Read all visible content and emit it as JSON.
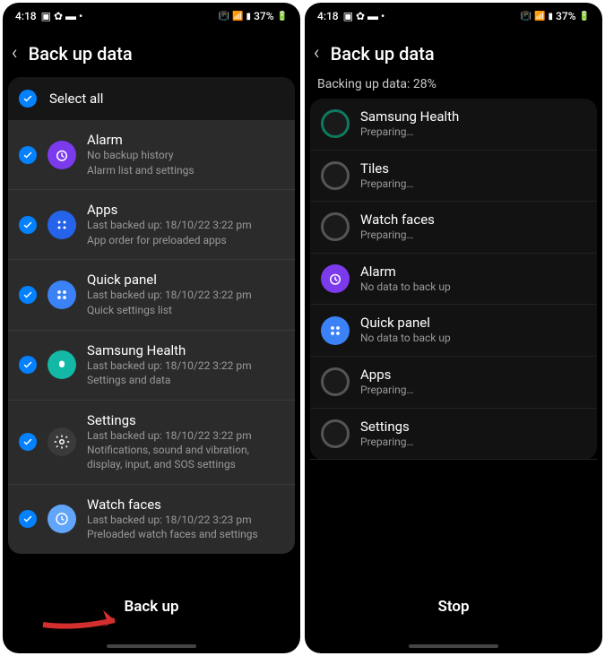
{
  "status": {
    "time": "4:18",
    "battery": "37%"
  },
  "left": {
    "title": "Back up data",
    "select_all": "Select all",
    "items": [
      {
        "title": "Alarm",
        "sub": "No backup history",
        "desc": "Alarm list and settings"
      },
      {
        "title": "Apps",
        "sub": "Last backed up: 18/10/22 3:22 pm",
        "desc": "App order for preloaded apps"
      },
      {
        "title": "Quick panel",
        "sub": "Last backed up: 18/10/22 3:22 pm",
        "desc": "Quick settings list"
      },
      {
        "title": "Samsung Health",
        "sub": "Last backed up: 18/10/22 3:22 pm",
        "desc": "Settings and data"
      },
      {
        "title": "Settings",
        "sub": "Last backed up: 18/10/22 3:22 pm",
        "desc": "Notifications, sound and vibration, display, input, and SOS settings"
      },
      {
        "title": "Watch faces",
        "sub": "Last backed up: 18/10/22 3:23 pm",
        "desc": "Preloaded watch faces and settings"
      }
    ],
    "button": "Back up"
  },
  "right": {
    "title": "Back up data",
    "progress": "Backing up data: 28%",
    "items": [
      {
        "title": "Samsung Health",
        "sub": "Preparing…"
      },
      {
        "title": "Tiles",
        "sub": "Preparing…"
      },
      {
        "title": "Watch faces",
        "sub": "Preparing…"
      },
      {
        "title": "Alarm",
        "sub": "No data to back up"
      },
      {
        "title": "Quick panel",
        "sub": "No data to back up"
      },
      {
        "title": "Apps",
        "sub": "Preparing…"
      },
      {
        "title": "Settings",
        "sub": "Preparing…"
      }
    ],
    "button": "Stop"
  }
}
